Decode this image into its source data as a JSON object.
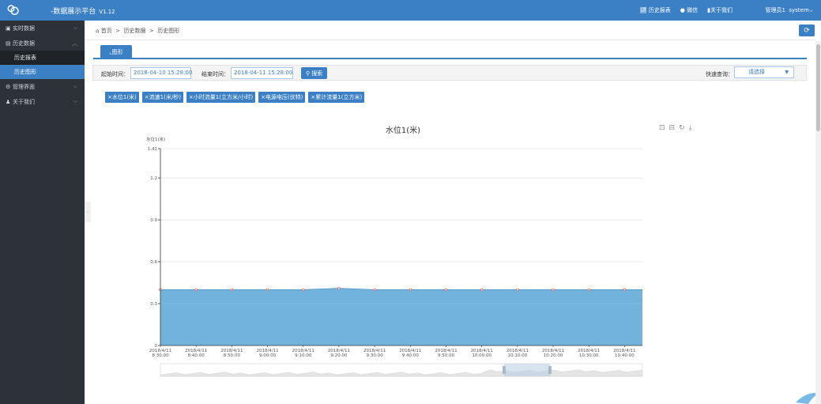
{
  "header": {
    "title": "-数据展示平台",
    "version": "V1.12",
    "nav": [
      "历史报表",
      "微信",
      "关于我们"
    ],
    "user": "管理员1",
    "account": "system",
    "bg_color": "#3b7fc4"
  },
  "sidebar": {
    "items": [
      {
        "label": "实时数据",
        "icon": "monitor-icon",
        "arrow": "chevron-down-icon"
      },
      {
        "label": "历史数据",
        "icon": "table-icon",
        "arrow": "chevron-up-icon"
      },
      {
        "label": "管理界面",
        "icon": "gear-icon",
        "arrow": "chevron-down-icon"
      },
      {
        "label": "关于我们",
        "icon": "user-icon",
        "arrow": "chevron-down-icon"
      }
    ],
    "sub_items": [
      {
        "label": "历史报表",
        "active": false
      },
      {
        "label": "历史图形",
        "active": true
      }
    ],
    "bg_color": "#2d3238"
  },
  "breadcrumb": {
    "home": "首页",
    "level1": "历史数据",
    "level2": "历史图形",
    "separator": ">"
  },
  "tab": {
    "label": "图形"
  },
  "filter": {
    "start_label": "起始时间：",
    "start_value": "2018-04-10 15:28:00",
    "end_label": "结束时间：",
    "end_value": "2018-04-11 15:28:00",
    "search_label": "搜索",
    "quick_label": "快速查询：",
    "quick_value": "请选择"
  },
  "chips": [
    "×水位1(米)",
    "×流速1(米/秒)",
    "×小时流量1(立方米/小时)",
    "×电源电压(伏特)",
    "×累计流量1(立方米)"
  ],
  "chart_data": {
    "type": "area",
    "title": "水位1(米)",
    "ylabel": "水位1(米)",
    "xlabel": "",
    "ylim": [
      0,
      1.41
    ],
    "y_ticks": [
      "0",
      "0.3",
      "0.6",
      "0.9",
      "1.2",
      "1.41"
    ],
    "y_tick_values": [
      0,
      0.3,
      0.6,
      0.9,
      1.2,
      1.41
    ],
    "categories": [
      "2018/4/11 8:30:00",
      "2018/4/11 8:40:00",
      "2018/4/11 8:50:00",
      "2018/4/11 9:00:00",
      "2018/4/11 9:10:00",
      "2018/4/11 9:20:00",
      "2018/4/11 9:30:00",
      "2018/4/11 9:40:00",
      "2018/4/11 9:50:00",
      "2018/4/11 10:00:00",
      "2018/4/11 10:10:00",
      "2018/4/11 10:20:00",
      "2018/4/11 10:30:00",
      "2018/4/11 10:40:00"
    ],
    "series": [
      {
        "values": [
          0.4,
          0.4,
          0.4,
          0.4,
          0.4,
          0.41,
          0.4,
          0.4,
          0.4,
          0.4,
          0.4,
          0.4,
          0.4,
          0.4
        ]
      }
    ],
    "grid": true,
    "area_color": "#6aafd9",
    "point_color": "#e05a5a"
  },
  "toolbox": [
    "zoom-icon",
    "zoom-reset-icon",
    "restore-icon",
    "download-icon"
  ]
}
